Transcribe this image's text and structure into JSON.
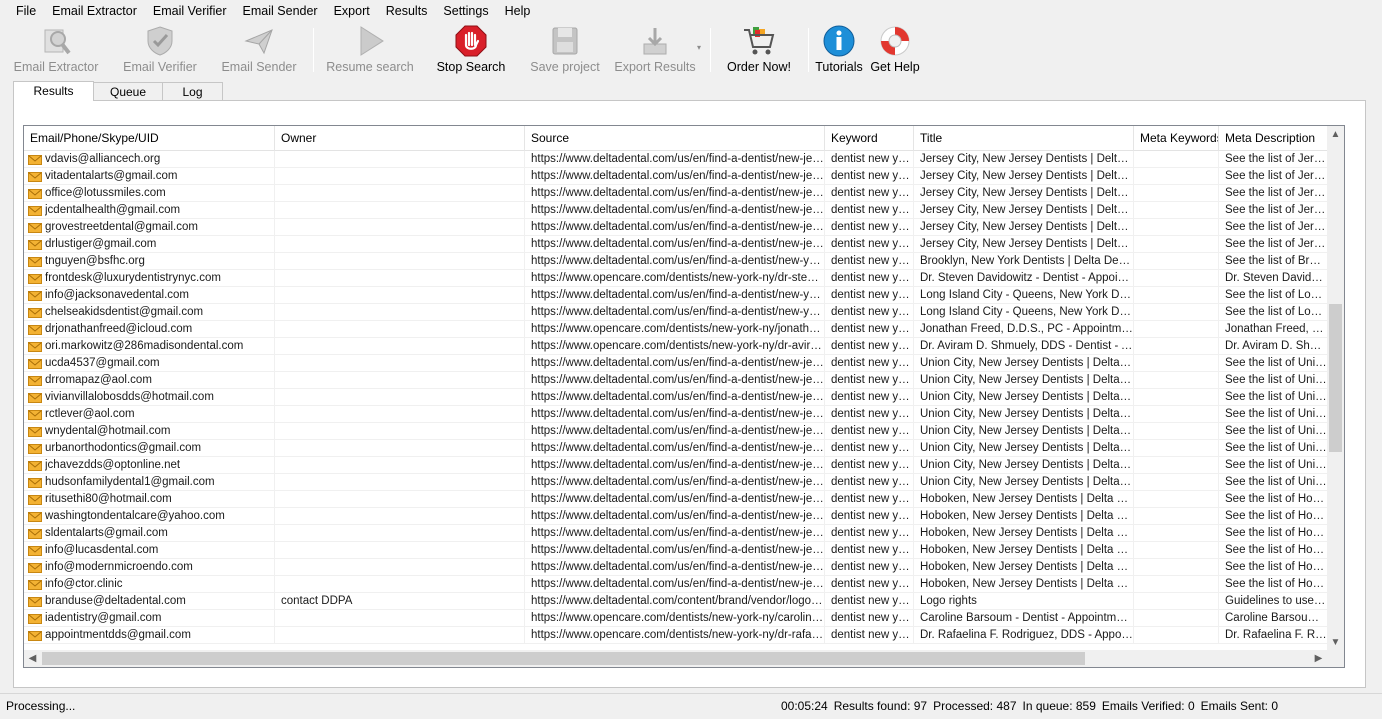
{
  "menu": [
    "File",
    "Email Extractor",
    "Email Verifier",
    "Email Sender",
    "Export",
    "Results",
    "Settings",
    "Help"
  ],
  "toolbar": {
    "email_extractor": "Email Extractor",
    "email_verifier": "Email Verifier",
    "email_sender": "Email Sender",
    "resume_search": "Resume search",
    "stop_search": "Stop Search",
    "save_project": "Save project",
    "export_results": "Export Results",
    "order_now": "Order Now!",
    "tutorials": "Tutorials",
    "get_help": "Get Help"
  },
  "tabs": [
    "Results",
    "Queue",
    "Log"
  ],
  "columns": [
    "Email/Phone/Skype/UID",
    "Owner",
    "Source",
    "Keyword",
    "Title",
    "Meta Keywords",
    "Meta Description"
  ],
  "rows": [
    [
      "vdavis@alliancech.org",
      "",
      "https://www.deltadental.com/us/en/find-a-dentist/new-jer...",
      "dentist new york",
      "Jersey City, New Jersey Dentists | Delta D...",
      "",
      "See the list of Jersey C"
    ],
    [
      "vitadentalarts@gmail.com",
      "",
      "https://www.deltadental.com/us/en/find-a-dentist/new-jer...",
      "dentist new york",
      "Jersey City, New Jersey Dentists | Delta D...",
      "",
      "See the list of Jersey C"
    ],
    [
      "office@lotussmiles.com",
      "",
      "https://www.deltadental.com/us/en/find-a-dentist/new-jer...",
      "dentist new york",
      "Jersey City, New Jersey Dentists | Delta D...",
      "",
      "See the list of Jersey C"
    ],
    [
      "jcdentalhealth@gmail.com",
      "",
      "https://www.deltadental.com/us/en/find-a-dentist/new-jer...",
      "dentist new york",
      "Jersey City, New Jersey Dentists | Delta D...",
      "",
      "See the list of Jersey C"
    ],
    [
      "grovestreetdental@gmail.com",
      "",
      "https://www.deltadental.com/us/en/find-a-dentist/new-jer...",
      "dentist new york",
      "Jersey City, New Jersey Dentists | Delta D...",
      "",
      "See the list of Jersey C"
    ],
    [
      "drlustiger@gmail.com",
      "",
      "https://www.deltadental.com/us/en/find-a-dentist/new-jer...",
      "dentist new york",
      "Jersey City, New Jersey Dentists | Delta D...",
      "",
      "See the list of Jersey C"
    ],
    [
      "tnguyen@bsfhc.org",
      "",
      "https://www.deltadental.com/us/en/find-a-dentist/new-yor...",
      "dentist new york",
      "Brooklyn, New York Dentists | Delta Dental",
      "",
      "See the list of Brookly"
    ],
    [
      "frontdesk@luxurydentistrynyc.com",
      "",
      "https://www.opencare.com/dentists/new-york-ny/dr-steve...",
      "dentist new york",
      "Dr. Steven Davidowitz - Dentist - Appoint...",
      "",
      "Dr. Steven Davidowit"
    ],
    [
      "info@jacksonavedental.com",
      "",
      "https://www.deltadental.com/us/en/find-a-dentist/new-yor...",
      "dentist new york",
      "Long Island City - Queens, New York Den...",
      "",
      "See the list of Long Is"
    ],
    [
      "chelseakidsdentist@gmail.com",
      "",
      "https://www.deltadental.com/us/en/find-a-dentist/new-yor...",
      "dentist new york",
      "Long Island City - Queens, New York Den...",
      "",
      "See the list of Long Is"
    ],
    [
      "drjonathanfreed@icloud.com",
      "",
      "https://www.opencare.com/dentists/new-york-ny/jonatha...",
      "dentist new york",
      "Jonathan Freed, D.D.S., PC - Appointments",
      "",
      "Jonathan Freed, D.D."
    ],
    [
      "ori.markowitz@286madisondental.com",
      "",
      "https://www.opencare.com/dentists/new-york-ny/dr-avira...",
      "dentist new york",
      "Dr. Aviram D. Shmuely, DDS - Dentist - Ap...",
      "",
      "Dr. Aviram D. Shmuel"
    ],
    [
      "ucda4537@gmail.com",
      "",
      "https://www.deltadental.com/us/en/find-a-dentist/new-jer...",
      "dentist new york",
      "Union City, New Jersey Dentists | Delta De...",
      "",
      "See the list of Union C"
    ],
    [
      "drromapaz@aol.com",
      "",
      "https://www.deltadental.com/us/en/find-a-dentist/new-jer...",
      "dentist new york",
      "Union City, New Jersey Dentists | Delta De...",
      "",
      "See the list of Union C"
    ],
    [
      "vivianvillalobosdds@hotmail.com",
      "",
      "https://www.deltadental.com/us/en/find-a-dentist/new-jer...",
      "dentist new york",
      "Union City, New Jersey Dentists | Delta De...",
      "",
      "See the list of Union C"
    ],
    [
      "rctlever@aol.com",
      "",
      "https://www.deltadental.com/us/en/find-a-dentist/new-jer...",
      "dentist new york",
      "Union City, New Jersey Dentists | Delta De...",
      "",
      "See the list of Union C"
    ],
    [
      "wnydental@hotmail.com",
      "",
      "https://www.deltadental.com/us/en/find-a-dentist/new-jer...",
      "dentist new york",
      "Union City, New Jersey Dentists | Delta De...",
      "",
      "See the list of Union C"
    ],
    [
      "urbanorthodontics@gmail.com",
      "",
      "https://www.deltadental.com/us/en/find-a-dentist/new-jer...",
      "dentist new york",
      "Union City, New Jersey Dentists | Delta De...",
      "",
      "See the list of Union C"
    ],
    [
      "jchavezdds@optonline.net",
      "",
      "https://www.deltadental.com/us/en/find-a-dentist/new-jer...",
      "dentist new york",
      "Union City, New Jersey Dentists | Delta De...",
      "",
      "See the list of Union C"
    ],
    [
      "hudsonfamilydental1@gmail.com",
      "",
      "https://www.deltadental.com/us/en/find-a-dentist/new-jer...",
      "dentist new york",
      "Union City, New Jersey Dentists | Delta De...",
      "",
      "See the list of Union C"
    ],
    [
      "ritusethi80@hotmail.com",
      "",
      "https://www.deltadental.com/us/en/find-a-dentist/new-jer...",
      "dentist new york",
      "Hoboken, New Jersey Dentists | Delta De...",
      "",
      "See the list of Hoboke"
    ],
    [
      "washingtondentalcare@yahoo.com",
      "",
      "https://www.deltadental.com/us/en/find-a-dentist/new-jer...",
      "dentist new york",
      "Hoboken, New Jersey Dentists | Delta De...",
      "",
      "See the list of Hoboke"
    ],
    [
      "sldentalarts@gmail.com",
      "",
      "https://www.deltadental.com/us/en/find-a-dentist/new-jer...",
      "dentist new york",
      "Hoboken, New Jersey Dentists | Delta De...",
      "",
      "See the list of Hoboke"
    ],
    [
      "info@lucasdental.com",
      "",
      "https://www.deltadental.com/us/en/find-a-dentist/new-jer...",
      "dentist new york",
      "Hoboken, New Jersey Dentists | Delta De...",
      "",
      "See the list of Hoboke"
    ],
    [
      "info@modernmicroendo.com",
      "",
      "https://www.deltadental.com/us/en/find-a-dentist/new-jer...",
      "dentist new york",
      "Hoboken, New Jersey Dentists | Delta De...",
      "",
      "See the list of Hoboke"
    ],
    [
      "info@ctor.clinic",
      "",
      "https://www.deltadental.com/us/en/find-a-dentist/new-jer...",
      "dentist new york",
      "Hoboken, New Jersey Dentists | Delta De...",
      "",
      "See the list of Hoboke"
    ],
    [
      "branduse@deltadental.com",
      "contact DDPA",
      "https://www.deltadental.com/content/brand/vendor/logo-...",
      "dentist new york",
      "Logo rights",
      "",
      "Guidelines to use the"
    ],
    [
      "iadentistry@gmail.com",
      "",
      "https://www.opencare.com/dentists/new-york-ny/caroline-...",
      "dentist new york",
      "Caroline Barsoum - Dentist - Appointments",
      "",
      "Caroline Barsoum - De"
    ],
    [
      "appointmentdds@gmail.com",
      "",
      "https://www.opencare.com/dentists/new-york-ny/dr-rafaeli...",
      "dentist new york",
      "Dr. Rafaelina F. Rodriguez, DDS - Appoint...",
      "",
      "Dr. Rafaelina F. Rodri"
    ]
  ],
  "status": {
    "left": "Processing...",
    "time": "00:05:24",
    "results_found": "Results found: 97",
    "processed": "Processed: 487",
    "in_queue": "In queue: 859",
    "emails_verified": "Emails Verified: 0",
    "emails_sent": "Emails Sent: 0"
  }
}
